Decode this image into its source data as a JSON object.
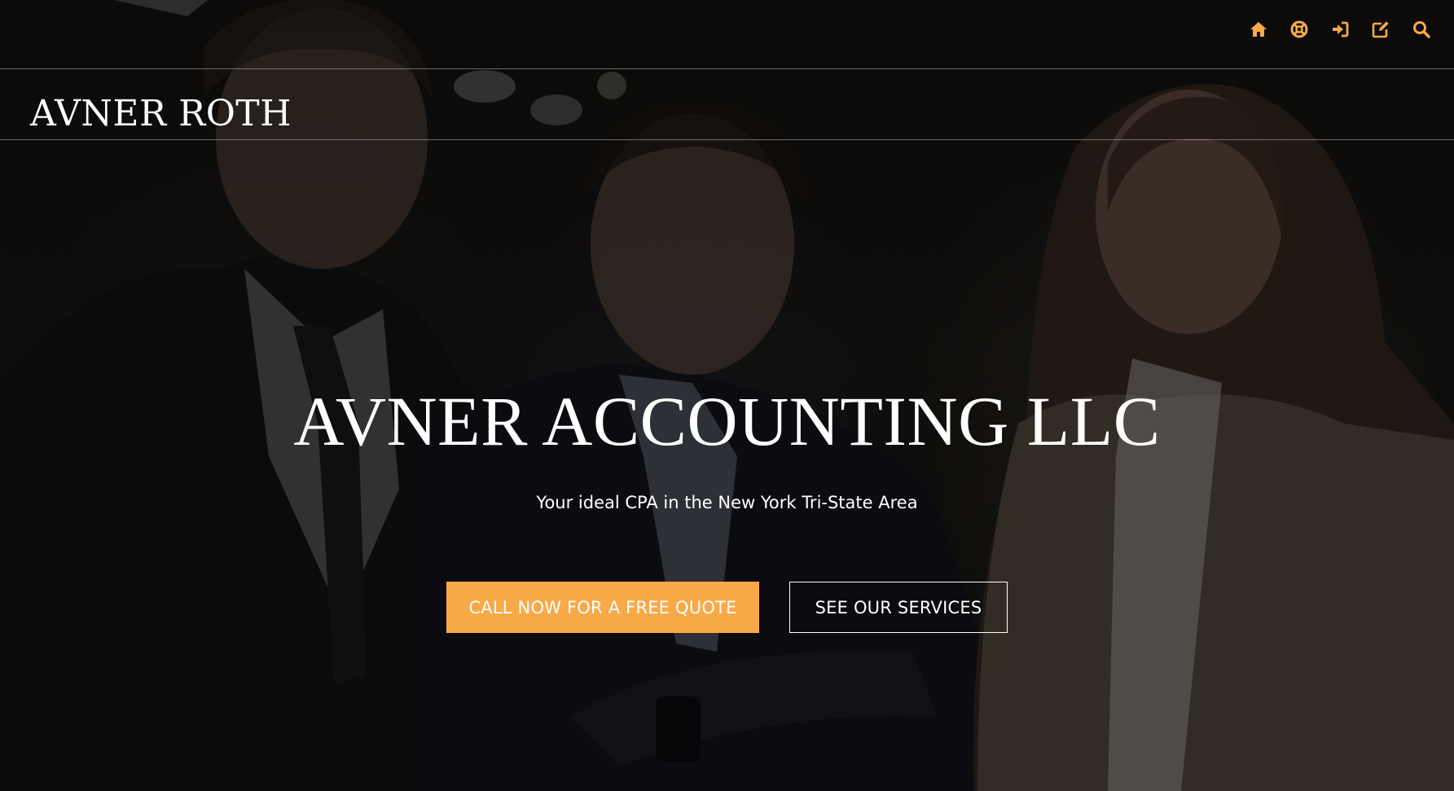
{
  "colors": {
    "accent": "#f9a948",
    "text": "#ffffff",
    "divider": "rgba(255,255,255,0.38)"
  },
  "topbar": {
    "icons": [
      {
        "name": "home-icon",
        "title": "Home"
      },
      {
        "name": "support-icon",
        "title": "Support"
      },
      {
        "name": "sign-in-icon",
        "title": "Sign in"
      },
      {
        "name": "edit-icon",
        "title": "Edit"
      },
      {
        "name": "search-icon",
        "title": "Search"
      }
    ]
  },
  "brand": {
    "name": "AVNER ROTH"
  },
  "hero": {
    "title": "AVNER ACCOUNTING LLC",
    "subtitle": "Your ideal CPA in the New York Tri-State Area",
    "primary_cta": "CALL NOW FOR A FREE QUOTE",
    "secondary_cta": "SEE OUR SERVICES"
  }
}
